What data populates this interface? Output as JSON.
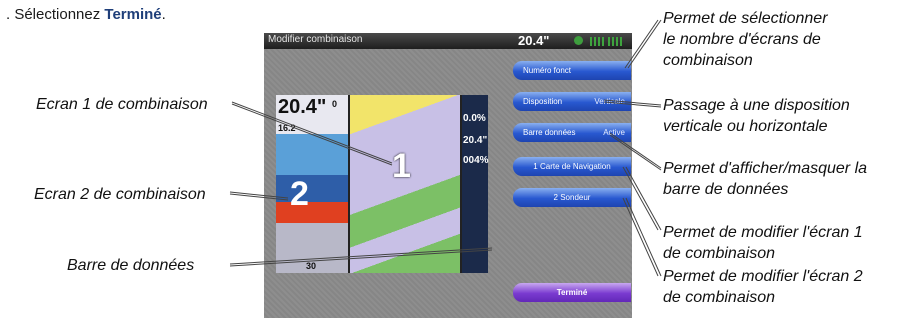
{
  "instruction": {
    "prefix": ". Sélectionnez ",
    "action": "Terminé",
    "suffix": "."
  },
  "device": {
    "title": "Modifier combinaison",
    "depth": "20.4\"",
    "icons": [
      "gps-icon",
      "signal-bars-icon",
      "signal-bars-icon"
    ],
    "sonar": {
      "depth": "20.4\"",
      "scale": [
        "0",
        "16.2",
        "30"
      ],
      "screen_number": "2"
    },
    "chart": {
      "screen_number": "1"
    },
    "data_bar": [
      "0.0%",
      "20.4\"",
      "004%"
    ],
    "buttons": [
      {
        "label": "Numéro fonct",
        "value": ""
      },
      {
        "label": "Disposition",
        "value": "Verticale"
      },
      {
        "label": "Barre données",
        "value": "Active"
      },
      {
        "label": "1 Carte de Navigation",
        "value": ""
      },
      {
        "label": "2 Sondeur",
        "value": ""
      }
    ],
    "done_button": "Terminé"
  },
  "callouts": {
    "left": [
      "Ecran 1 de combinaison",
      "Ecran 2 de combinaison",
      "Barre de données"
    ],
    "right": [
      [
        "Permet de sélectionner",
        "le nombre d'écrans de",
        "combinaison"
      ],
      [
        "Passage à une disposition",
        "verticale ou horizontale"
      ],
      [
        "Permet d'afficher/masquer la",
        "barre de données"
      ],
      [
        "Permet de modifier l'écran 1",
        "de combinaison"
      ],
      [
        "Permet de modifier l'écran 2",
        "de combinaison"
      ]
    ]
  },
  "colors": {
    "button": "#2858d0",
    "done": "#7a3ad0",
    "title": "#1f3f7a"
  }
}
